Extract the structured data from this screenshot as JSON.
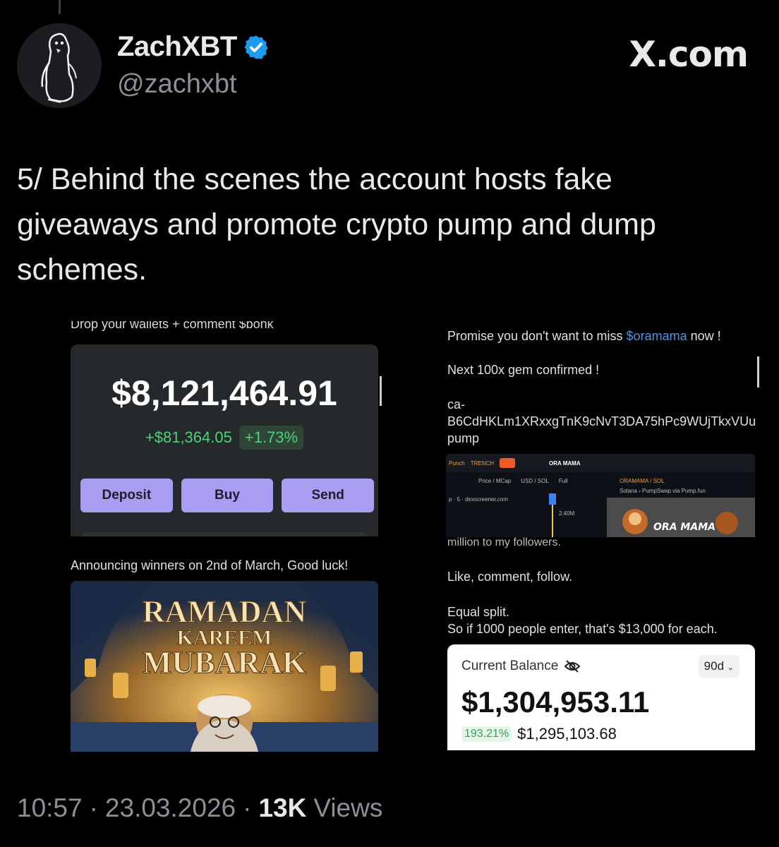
{
  "author": {
    "name": "ZachXBT",
    "handle": "@zachxbt",
    "verified": true
  },
  "brand": "X.com",
  "tweet": {
    "text": "5/ Behind the scenes the account hosts fake giveaways and promote crypto pump and dump schemes."
  },
  "media_left": {
    "cut_text": "Drop your wallets + comment $bonk",
    "wallet_amount": "$8,121,464.91",
    "wallet_change": "+$81,364.05",
    "wallet_change_pct": "+1.73%",
    "actions": [
      "Deposit",
      "Buy",
      "Send"
    ],
    "announce": "Announcing winners on 2nd of March, Good luck!",
    "image_title_1": "RAMADAN",
    "image_title_2": "KAREEM",
    "image_title_3": "MUBARAK"
  },
  "media_right": {
    "line1_prefix": "Promise you don't want to miss ",
    "line1_cashtag": "$oramama",
    "line1_suffix": " now !",
    "line2": "Next 100x gem confirmed !",
    "ca_label": "ca-",
    "ca_code": "B6CdHKLm1XRxxgTnK9cNvT3DA75hPc9WUjTkxVUupump",
    "chart": {
      "punch": "Punch",
      "trench": "TRENCH",
      "token_name": "ORA MAMA",
      "pair": "ORAMAMA / SOL",
      "tabs": [
        "Price / MCap",
        "USD / SOL",
        "Full"
      ],
      "source": "p · 5 · dexscreener.com",
      "value": "2.40M",
      "chain": "Solana › PumpSwap via Pump.fun",
      "image_text": "ORA MAMA"
    },
    "cut_text": "million to my followers.",
    "line3": "Like, comment, follow.",
    "line4": "Equal split.",
    "line5": "So if 1000 people enter, that's $13,000 for each.",
    "balance": {
      "label": "Current Balance",
      "period": "90d",
      "amount": "$1,304,953.11",
      "pct": "193.21%",
      "change": "$1,295,103.68"
    }
  },
  "meta": {
    "time": "10:57",
    "date": "23.03.2026",
    "views_count": "13K",
    "views_label": "Views"
  },
  "colors": {
    "background": "#000000",
    "verified": "#1d9bf0",
    "cashtag": "#4c97e0",
    "wallet_button": "#a99df2",
    "positive": "#4ad27a"
  }
}
